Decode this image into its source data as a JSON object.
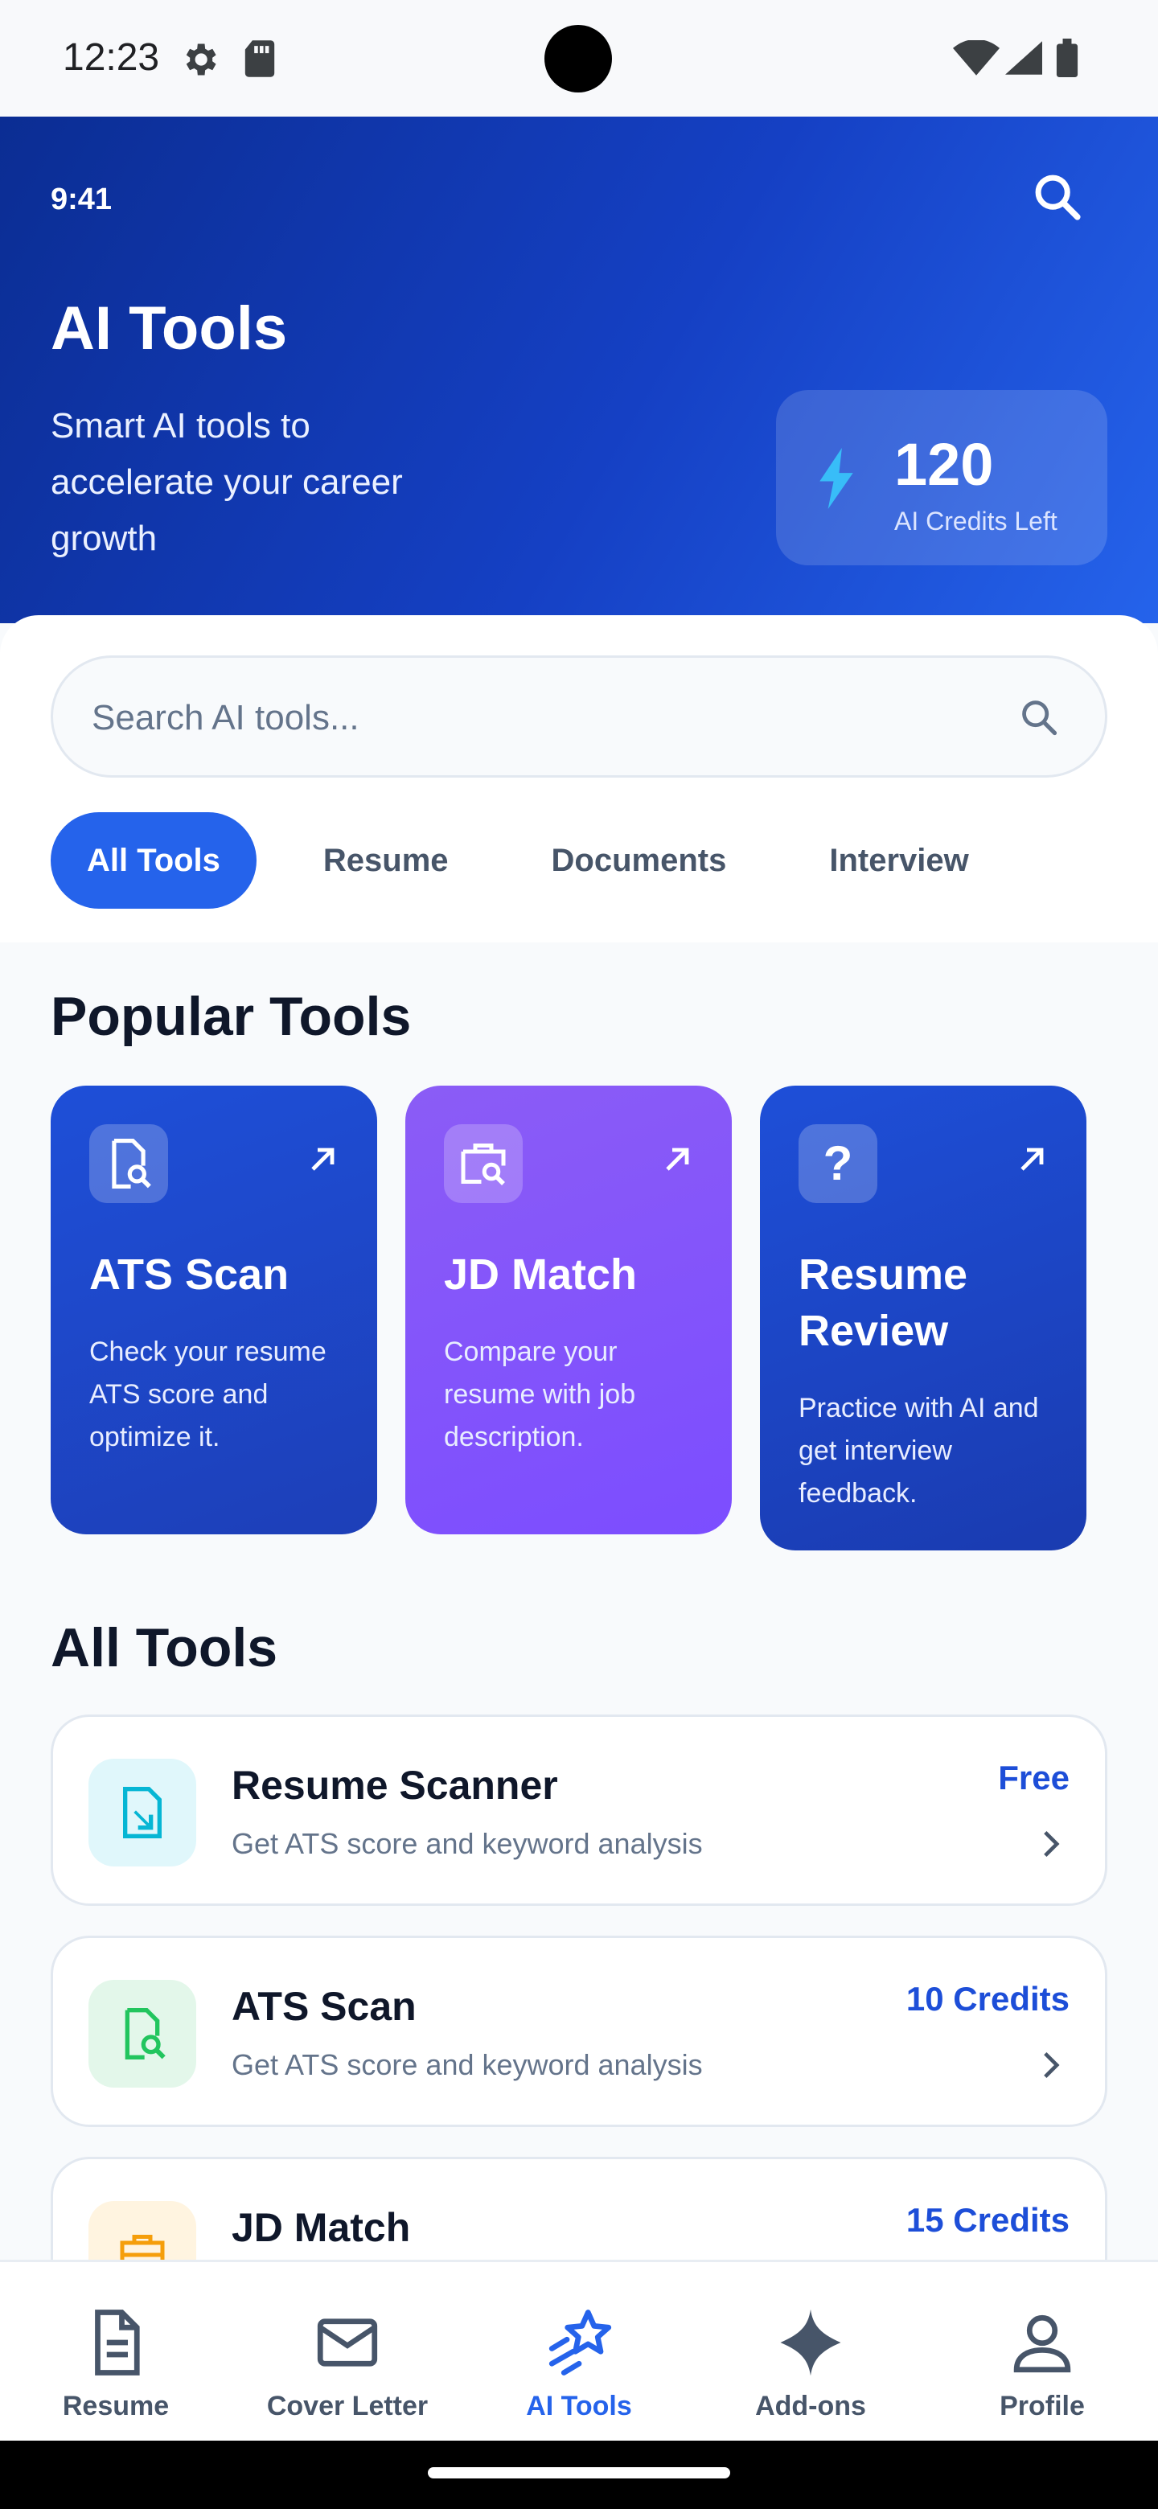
{
  "system_bar": {
    "time": "12:23"
  },
  "header": {
    "time": "9:41",
    "title": "AI Tools",
    "subtitle": "Smart AI tools to accelerate your career growth",
    "credits": {
      "value": "120",
      "label": "AI Credits Left"
    }
  },
  "search": {
    "placeholder": "Search AI tools..."
  },
  "filters": [
    "All Tools",
    "Resume",
    "Documents",
    "Interview"
  ],
  "active_filter": "All Tools",
  "popular": {
    "title": "Popular Tools",
    "cards": [
      {
        "title": "ATS Scan",
        "description": "Check your resume ATS score and optimize it.",
        "icon": "doc-search-icon",
        "color": "#1d4ed8"
      },
      {
        "title": "JD Match",
        "description": "Compare your resume with job description.",
        "icon": "briefcase-search-icon",
        "color": "#7c4dff"
      },
      {
        "title": "Resume Review",
        "description": "Practice with AI and get interview feedback.",
        "icon": "question-icon",
        "color": "#1e40af"
      }
    ]
  },
  "all_tools": {
    "title": "All Tools",
    "items": [
      {
        "name": "Resume Scanner",
        "description": "Get ATS score and keyword analysis",
        "price": "Free",
        "icon": "doc-scan-icon",
        "color": "#06b6d4"
      },
      {
        "name": "ATS Scan",
        "description": "Get ATS score and keyword analysis",
        "price": "10 Credits",
        "icon": "doc-search-icon",
        "color": "#22c55e"
      },
      {
        "name": "JD Match",
        "description": "",
        "price": "15 Credits",
        "icon": "briefcase-icon",
        "color": "#f59e0b"
      }
    ]
  },
  "nav": {
    "items": [
      "Resume",
      "Cover Letter",
      "AI Tools",
      "Add-ons",
      "Profile"
    ],
    "active": "AI Tools"
  },
  "colors": {
    "primary": "#2563eb",
    "hero_dark": "#0b2d93",
    "purple": "#7c4dff"
  }
}
